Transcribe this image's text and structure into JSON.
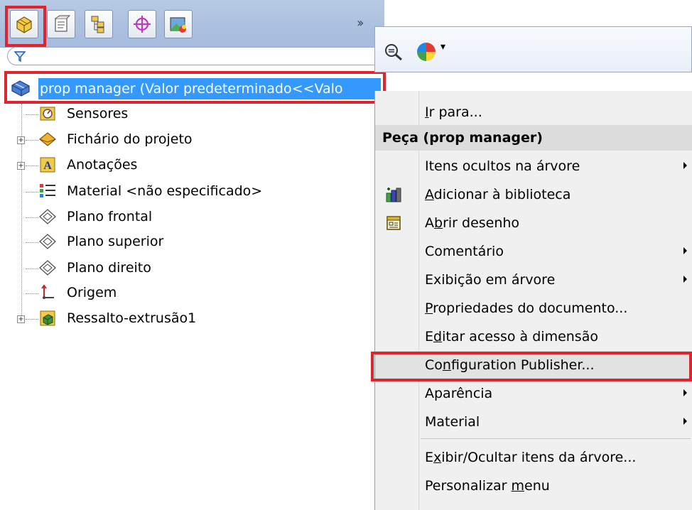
{
  "tabs": [
    {
      "name": "FeatureManager design tree",
      "icon": "feature-tree-icon"
    },
    {
      "name": "PropertyManager",
      "icon": "property-manager-icon"
    },
    {
      "name": "ConfigurationManager",
      "icon": "configuration-icon"
    },
    {
      "name": "DimXpertManager",
      "icon": "dimxpert-icon"
    },
    {
      "name": "DisplayManager",
      "icon": "display-manager-icon"
    }
  ],
  "tree": {
    "root_label": "prop manager  (Valor predeterminado<<Valo",
    "items": [
      {
        "label": "Sensores",
        "icon": "sensor-icon",
        "expandable": false
      },
      {
        "label": "Fichário do projeto",
        "icon": "design-binder-icon",
        "expandable": true
      },
      {
        "label": "Anotações",
        "icon": "annotations-icon",
        "expandable": true
      },
      {
        "label": "Material <não especificado>",
        "icon": "material-icon",
        "expandable": false
      },
      {
        "label": "Plano frontal",
        "icon": "plane-icon",
        "expandable": false
      },
      {
        "label": "Plano superior",
        "icon": "plane-icon",
        "expandable": false
      },
      {
        "label": "Plano direito",
        "icon": "plane-icon",
        "expandable": false
      },
      {
        "label": "Origem",
        "icon": "origin-icon",
        "expandable": false
      },
      {
        "label": "Ressalto-extrusão1",
        "icon": "extrude-icon",
        "expandable": true
      }
    ]
  },
  "context_menu": {
    "toolbar_icons": [
      "zoom-to-selection-icon",
      "appearance-icon"
    ],
    "goto": {
      "pre": "",
      "u": "I",
      "post": "r para..."
    },
    "header": "Peça (prop manager)",
    "items": [
      {
        "pre": "",
        "u": "",
        "post": "Itens ocultos na árvore",
        "submenu": true,
        "icon": ""
      },
      {
        "pre": "",
        "u": "A",
        "post": "dicionar à biblioteca",
        "submenu": false,
        "icon": "add-to-library-icon"
      },
      {
        "pre": "A",
        "u": "b",
        "post": "rir desenho",
        "submenu": false,
        "icon": "open-drawing-icon"
      },
      {
        "pre": "",
        "u": "",
        "post": "Comentário",
        "submenu": true,
        "icon": ""
      },
      {
        "pre": "",
        "u": "",
        "post": "Exibição em árvore",
        "submenu": true,
        "icon": ""
      },
      {
        "pre": "",
        "u": "P",
        "post": "ropriedades do documento...",
        "submenu": false,
        "icon": ""
      },
      {
        "pre": "E",
        "u": "d",
        "post": "itar acesso à dimensão",
        "submenu": false,
        "icon": ""
      },
      {
        "pre": "Co",
        "u": "n",
        "post": "figuration Publisher...",
        "submenu": false,
        "icon": ""
      },
      {
        "pre": "",
        "u": "",
        "post": "Aparência",
        "submenu": true,
        "icon": ""
      },
      {
        "pre": "",
        "u": "",
        "post": "Material",
        "submenu": true,
        "icon": ""
      },
      {
        "pre": "E",
        "u": "x",
        "post": "ibir/Ocultar itens da árvore...",
        "submenu": false,
        "icon": ""
      },
      {
        "pre": "Personalizar ",
        "u": "m",
        "post": "enu",
        "submenu": false,
        "icon": ""
      }
    ]
  },
  "colors": {
    "highlight": "#3399ff",
    "callout": "#e0242e",
    "tabbar": "#b7c9e4"
  }
}
